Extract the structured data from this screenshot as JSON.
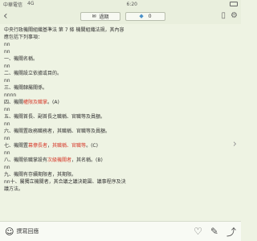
{
  "status_bar": {
    "carrier": "中華電信",
    "network": "4G",
    "time": "6:20"
  },
  "header": {
    "back_icon": "chevron-left-icon",
    "tab_label": "過期",
    "tab_icon": "envelope-icon",
    "diamond_icon": "diamond-icon",
    "diamond_count": "0",
    "icons": [
      "font-size-icon",
      "gear-icon"
    ]
  },
  "content": {
    "lines": [
      "中央行政機關組織基準法 第 7 條 機關組織法規，其內容",
      "應包括下列事項：",
      "nn",
      "nn",
      "一、機關名稱。",
      "nn",
      "二、機關設立依據或目的。",
      "nn",
      "三、機關隸屬關係。",
      "nnnn",
      "四、機關權限及職掌。(A)",
      "nn",
      "五、機關首長、副首長之職稱、官職等及員額。",
      "nn",
      "六、機關置政務職務者，其職稱、官職等及員額。",
      "nn",
      "七、機關置幕僚長者，其職稱、官職等。(C)",
      "nn",
      "八、機關依職掌設有次級機關者，其名稱。(B)",
      "nn",
      "九、機關有存續期限者，其期限。",
      "nn十、屬獨立機關者，其合議之議決範圍、議事程序及決",
      "議方法。"
    ],
    "highlights": {
      "line_10": "權限及職掌",
      "line_16a": "幕僚長者",
      "line_16b": "其職稱、官職等",
      "line_18": "次級機關者"
    }
  },
  "bottom_bar": {
    "reply_label": "撰寫回應"
  },
  "colors": {
    "background": "#eef3e3",
    "highlight": "#d63b2c",
    "diamond": "#4a90c8"
  }
}
